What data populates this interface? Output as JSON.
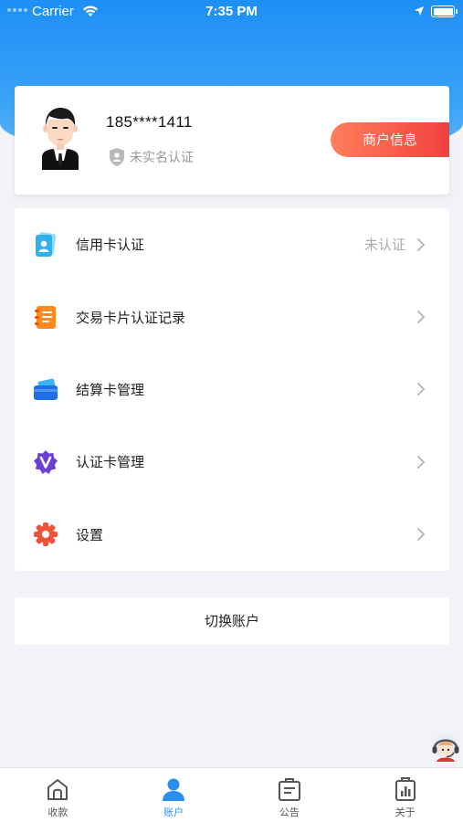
{
  "status_bar": {
    "carrier": "Carrier",
    "time": "7:35 PM"
  },
  "profile": {
    "phone": "185****1411",
    "verify_status": "未实名认证",
    "merchant_button": "商户信息"
  },
  "menu": {
    "items": [
      {
        "label": "信用卡认证",
        "value": "未认证",
        "icon": "credit-card-id-icon"
      },
      {
        "label": "交易卡片认证记录",
        "value": "",
        "icon": "record-book-icon"
      },
      {
        "label": "结算卡管理",
        "value": "",
        "icon": "wallet-card-icon"
      },
      {
        "label": "认证卡管理",
        "value": "",
        "icon": "verified-v-badge-icon"
      },
      {
        "label": "设置",
        "value": "",
        "icon": "gear-icon"
      }
    ]
  },
  "switch_account": "切换账户",
  "tabbar": {
    "tabs": [
      {
        "label": "收款",
        "icon": "home-icon"
      },
      {
        "label": "账户",
        "icon": "user-icon"
      },
      {
        "label": "公告",
        "icon": "notice-icon"
      },
      {
        "label": "关于",
        "icon": "about-chart-icon"
      }
    ],
    "active_index": 1
  },
  "colors": {
    "primary_blue": "#2b8ff0",
    "merchant_red": "#f2403d",
    "orange": "#ff7f5c"
  }
}
